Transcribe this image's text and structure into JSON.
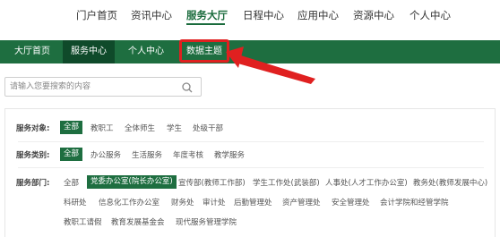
{
  "top_nav": {
    "items": [
      "门户首页",
      "资讯中心",
      "服务大厅",
      "日程中心",
      "应用中心",
      "资源中心",
      "个人中心"
    ],
    "active": "服务大厅"
  },
  "sub_nav": {
    "tabs": [
      "大厅首页",
      "服务中心",
      "个人中心",
      "数据主题"
    ],
    "selected": "服务中心",
    "highlighted": "数据主题"
  },
  "search": {
    "placeholder": "请输入您要搜索的内容",
    "value": ""
  },
  "filters": {
    "object": {
      "label": "服务对象:",
      "options": [
        "全部",
        "教职工",
        "全体师生",
        "学生",
        "处级干部"
      ],
      "selected": "全部"
    },
    "category": {
      "label": "服务类别:",
      "options": [
        "全部",
        "办公服务",
        "生活服务",
        "年度考核",
        "教学服务"
      ],
      "selected": "全部"
    },
    "department": {
      "label": "服务部门:",
      "row1": [
        "全部",
        "党委办公室(院长办公室)",
        "宣传部(教师工作部)",
        "学生工作处(武装部)",
        "人事处(人才工作办公室)",
        "教务处(教师发展中心)"
      ],
      "row2": [
        "科研处",
        "信息化工作办公室",
        "财务处",
        "审计处",
        "后勤管理处",
        "资产管理处",
        "安全管理处",
        "会计学院和经管学院"
      ],
      "row3": [
        "教职工请假",
        "教育发展基金会",
        "现代服务管理学院"
      ],
      "selected": "党委办公室(院长办公室)"
    }
  },
  "colors": {
    "primary_green": "#1e6e40",
    "dark_green": "#0f4a2a",
    "annotation_red": "#e02020"
  }
}
